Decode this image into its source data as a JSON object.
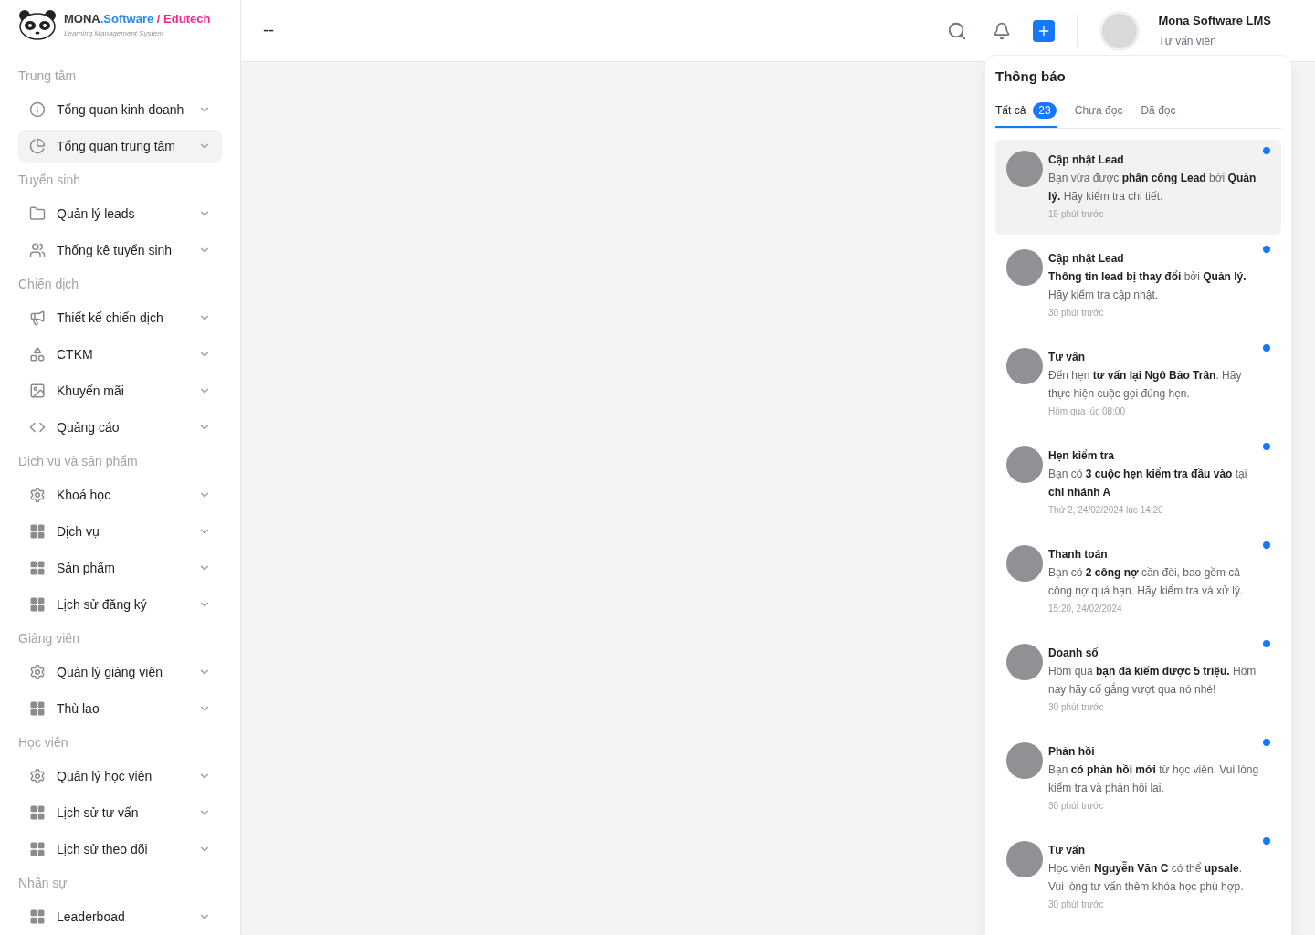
{
  "brand": {
    "name": "MONA",
    "domain": ".Software",
    "divider": " / ",
    "product": "Edutech",
    "tagline": "Learning Management System"
  },
  "sidebar": {
    "groups": [
      {
        "title": "Trung tâm",
        "items": [
          {
            "label": "Tổng quan kinh doanh",
            "kind": "info",
            "selected": false
          },
          {
            "label": "Tổng quan trung tâm",
            "kind": "chart",
            "selected": true
          }
        ]
      },
      {
        "title": "Tuyển sinh",
        "items": [
          {
            "label": "Quản lý leads",
            "kind": "folder",
            "selected": false
          },
          {
            "label": "Thống kê tuyển sinh",
            "kind": "users",
            "selected": false
          }
        ]
      },
      {
        "title": "Chiến dịch",
        "items": [
          {
            "label": "Thiết kế chiến dịch",
            "kind": "ad",
            "selected": false
          },
          {
            "label": "CTKM",
            "kind": "shapes",
            "selected": false
          },
          {
            "label": "Khuyến mãi",
            "kind": "picture",
            "selected": false
          },
          {
            "label": "Quảng cáo",
            "kind": "code",
            "selected": false
          }
        ]
      },
      {
        "title": "Dịch vụ và sản phẩm",
        "items": [
          {
            "label": "Khoá học",
            "kind": "gear",
            "selected": false
          },
          {
            "label": "Dịch vụ",
            "kind": "grid",
            "selected": false
          },
          {
            "label": "Sản phẩm",
            "kind": "grid",
            "selected": false
          },
          {
            "label": "Lịch sử đăng ký",
            "kind": "grid",
            "selected": false
          }
        ]
      },
      {
        "title": "Giảng viên",
        "items": [
          {
            "label": "Quản lý giảng viên",
            "kind": "gear",
            "selected": false
          },
          {
            "label": "Thù lao",
            "kind": "grid",
            "selected": false
          }
        ]
      },
      {
        "title": "Học viên",
        "items": [
          {
            "label": "Quản lý học viên",
            "kind": "gear",
            "selected": false
          },
          {
            "label": "Lịch sử tư vấn",
            "kind": "grid",
            "selected": false
          },
          {
            "label": "Lịch sử theo dõi",
            "kind": "grid",
            "selected": false
          }
        ]
      },
      {
        "title": "Nhân sự",
        "items": [
          {
            "label": "Leaderboad",
            "kind": "grid",
            "selected": false
          }
        ]
      }
    ]
  },
  "header": {
    "page_title": "--",
    "user": {
      "name": "Mona Software LMS",
      "role": "Tư vấn viên"
    }
  },
  "notifications": {
    "title": "Thông báo",
    "tabs": [
      {
        "label": "Tất cả",
        "count": "23",
        "selected": true
      },
      {
        "label": "Chưa đọc",
        "selected": false
      },
      {
        "label": "Đã đọc",
        "selected": false
      }
    ],
    "items": [
      {
        "title": "Cập nhật Lead",
        "body": "Bạn vừa được **phân công Lead** bởi **Quản lý.** Hãy kiểm tra chi tiết.",
        "time": "15 phút trước",
        "unread": true,
        "selected": true
      },
      {
        "title": "Cập nhật Lead",
        "body": "**Thông tin lead bị thay đổi** bởi **Quản lý.** Hãy kiểm tra cập nhật.",
        "time": "30 phút trước",
        "unread": true,
        "selected": false
      },
      {
        "title": "Tư vấn",
        "body": "Đến hẹn **tư vấn lại Ngô Bảo Trân**. Hãy thực hiện cuộc gọi đúng hẹn.",
        "time": "Hôm qua lúc 08:00",
        "unread": true,
        "selected": false
      },
      {
        "title": "Hẹn kiểm tra",
        "body": "Bạn có **3 cuộc hẹn kiểm tra đầu vào** tại **chi nhánh A**",
        "time": "Thứ 2, 24/02/2024 lúc 14:20",
        "unread": true,
        "selected": false
      },
      {
        "title": "Thanh toán",
        "body": "Bạn có **2 công nợ** cần đòi, bao gồm cả công nợ quá hạn. Hãy kiểm tra và xử lý.",
        "time": "15:20, 24/02/2024",
        "unread": true,
        "selected": false
      },
      {
        "title": "Doanh số",
        "body": "Hôm qua **bạn đã kiếm được 5 triệu.** Hôm nay hãy cố gắng vượt qua nó nhé!",
        "time": "30 phút trước",
        "unread": true,
        "selected": false
      },
      {
        "title": "Phản hồi",
        "body": "Bạn **có phản hồi mới** từ học viên. Vui lòng kiểm tra và phản hồi lại.",
        "time": "30 phút trước",
        "unread": true,
        "selected": false
      },
      {
        "title": "Tư vấn",
        "body": "Học viên **Nguyễn Văn C** có thể **upsale**. Vui lòng tư vấn thêm khóa học phù hợp.",
        "time": "30 phút trước",
        "unread": true,
        "selected": false
      }
    ]
  }
}
